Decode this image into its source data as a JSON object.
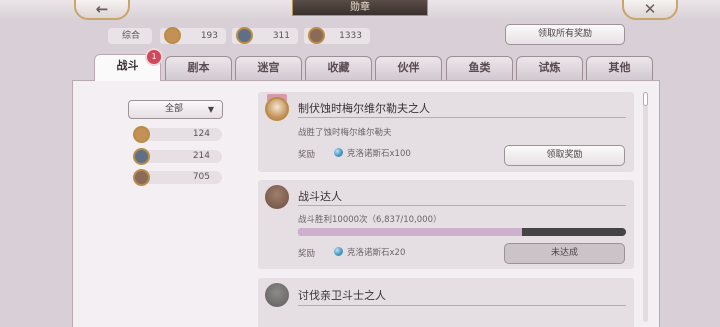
{
  "header": {
    "title": "勋章",
    "back_icon": "←",
    "close_icon": "✕"
  },
  "summary": {
    "label": "综合",
    "gold_count": "193",
    "silver_count": "311",
    "bronze_count": "1333",
    "claim_all_label": "领取所有奖励"
  },
  "tabs": [
    {
      "label": "战斗",
      "active": true
    },
    {
      "label": "剧本"
    },
    {
      "label": "迷宫"
    },
    {
      "label": "收藏"
    },
    {
      "label": "伙伴"
    },
    {
      "label": "鱼类"
    },
    {
      "label": "试炼"
    },
    {
      "label": "其他"
    }
  ],
  "tab_badge": "1",
  "filter": {
    "selected": "全部",
    "arrow": "▼"
  },
  "medal_counts": {
    "gold": "124",
    "silver": "214",
    "bronze": "705"
  },
  "colors": {
    "gold": "#c39055",
    "silver": "#5f6f86",
    "bronze": "#8a6a58",
    "badge": "#d0495a",
    "progress_fill": "#cdb0cd"
  },
  "achievements": [
    {
      "title": "制伏蚀时梅尔维尔勒夫之人",
      "desc": "战胜了蚀时梅尔维尔勒夫",
      "reward_label": "奖励",
      "reward": "克洛诺斯石x100",
      "button": "领取奖励"
    },
    {
      "title": "战斗达人",
      "desc": "战斗胜利10000次（6,837/10,000）",
      "progress": 0.6837,
      "reward_label": "奖励",
      "reward": "克洛诺斯石x20",
      "button": "未达成"
    },
    {
      "title": "讨伐亲卫斗士之人"
    }
  ]
}
